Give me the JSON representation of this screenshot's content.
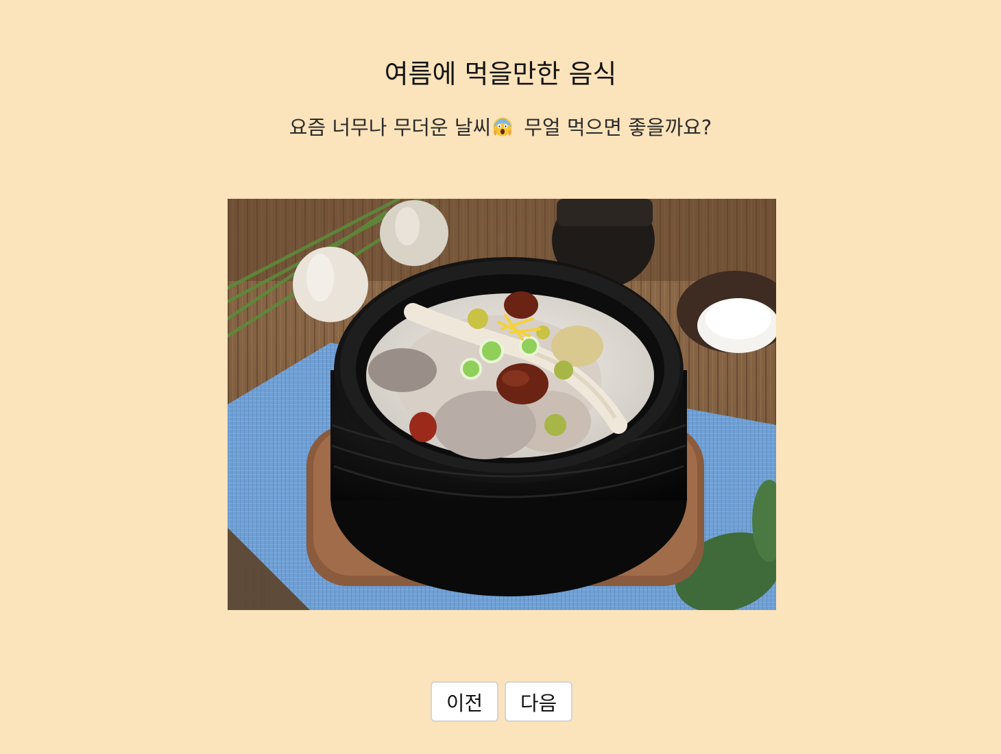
{
  "header": {
    "title": "여름에 먹을만한 음식",
    "subtitle_before": "요즘 너무나 무더운 날씨",
    "subtitle_after": "무얼 먹으면 좋을까요?",
    "emoji_icon": "face-screaming-in-fear-icon"
  },
  "photo": {
    "subject": "samgyetang",
    "description_icon": "food-photo"
  },
  "nav": {
    "prev_label": "이전",
    "next_label": "다음"
  },
  "colors": {
    "background": "#fbe3bb",
    "button_bg": "#ffffff",
    "button_border": "#d4d4d4"
  }
}
